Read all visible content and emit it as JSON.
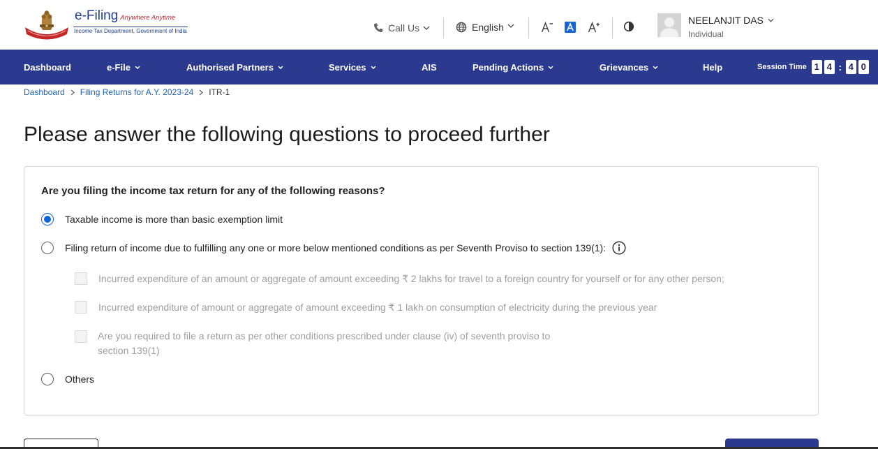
{
  "header": {
    "logo": {
      "title": "e-Filing",
      "tagline": "Anywhere Anytime",
      "subtitle": "Income Tax Department, Government of India"
    },
    "call_us": "Call Us",
    "language": "English",
    "text_size": {
      "decrease_active": false,
      "default_active": true,
      "increase_active": false
    },
    "user": {
      "name": "NEELANJIT DAS",
      "role": "Individual"
    }
  },
  "nav": {
    "items": [
      {
        "label": "Dashboard",
        "dropdown": false
      },
      {
        "label": "e-File",
        "dropdown": true
      },
      {
        "label": "Authorised Partners",
        "dropdown": true
      },
      {
        "label": "Services",
        "dropdown": true
      },
      {
        "label": "AIS",
        "dropdown": false
      },
      {
        "label": "Pending Actions",
        "dropdown": true
      },
      {
        "label": "Grievances",
        "dropdown": true
      },
      {
        "label": "Help",
        "dropdown": false
      }
    ],
    "session": {
      "label": "Session Time",
      "minutes": [
        "1",
        "4"
      ],
      "separator": ":",
      "seconds": [
        "4",
        "0"
      ]
    }
  },
  "breadcrumb": [
    {
      "label": "Dashboard"
    },
    {
      "label": "Filing Returns for A.Y. 2023-24"
    },
    {
      "label": "ITR-1"
    }
  ],
  "page_title": "Please answer the following questions to proceed further",
  "question": {
    "text": "Are you filing the income tax return for any of the following reasons?",
    "options": [
      {
        "label": "Taxable income is more than basic exemption limit",
        "selected": true
      },
      {
        "label": "Filing return of income due to fulfilling any one or more below mentioned conditions as per Seventh Proviso to section 139(1):",
        "selected": false,
        "has_info": true,
        "conditions": [
          {
            "label": "Incurred expenditure of an amount or aggregate of amount exceeding ₹ 2 lakhs for travel to a foreign country for yourself or for any other person;",
            "checked": false,
            "disabled": true
          },
          {
            "label": "Incurred expenditure of amount or aggregate of amount exceeding ₹ 1 lakh on consumption of electricity during the previous year",
            "checked": false,
            "disabled": true
          },
          {
            "label": "Are you required to file a return as per other conditions prescribed under clause (iv) of seventh proviso to section 139(1)",
            "checked": false,
            "disabled": true
          }
        ]
      },
      {
        "label": "Others",
        "selected": false
      }
    ]
  },
  "icons": {
    "logo": "national-emblem-logo",
    "call_us": "phone-icon",
    "language": "globe-icon",
    "dropdown": "chevron-down-icon",
    "text_decrease": "decrease-text-size-icon",
    "text_default": "default-text-size-icon",
    "text_increase": "increase-text-size-icon",
    "contrast": "contrast-icon",
    "user": "avatar",
    "breadcrumb_separator": "chevron-right-icon",
    "info": "info-icon"
  },
  "colors": {
    "nav_bg": "#2b3a8e",
    "link": "#1f62b5",
    "selected": "#1565d8",
    "disabled_text": "#9e9e9e",
    "tagline": "#c1272d",
    "logo_blue": "#1f3d8a",
    "primary_button": "#2b3a8e"
  }
}
